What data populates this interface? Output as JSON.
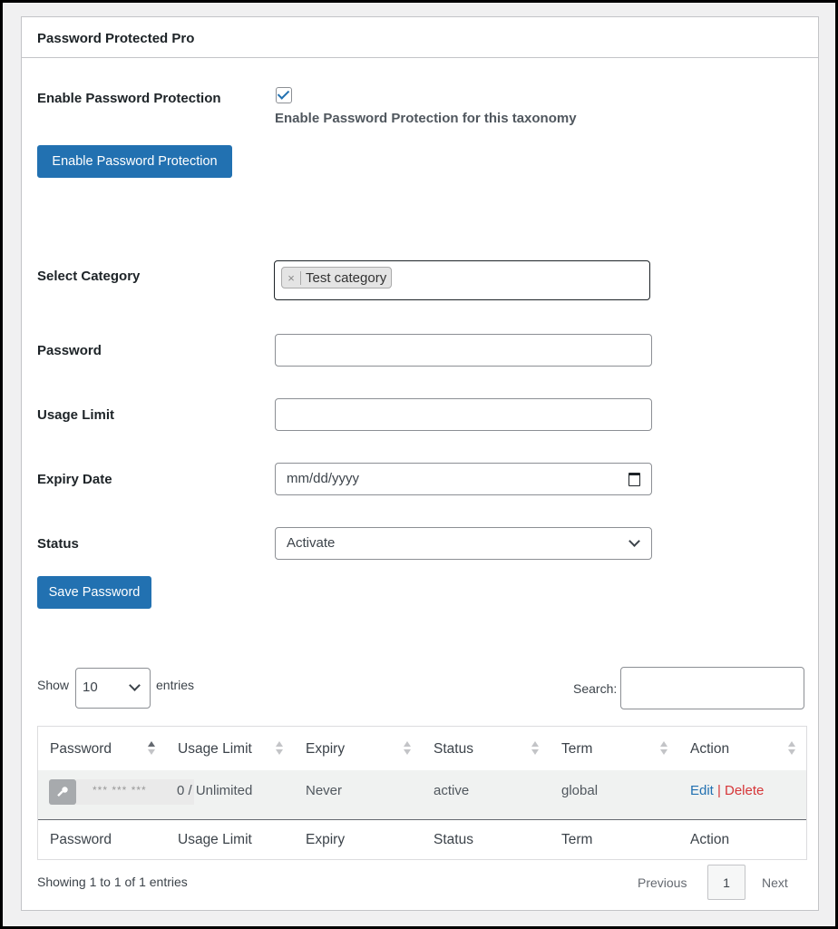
{
  "panel": {
    "title": "Password Protected Pro"
  },
  "enable": {
    "label": "Enable Password Protection",
    "checked": true,
    "description": "Enable Password Protection for this taxonomy",
    "button": "Enable Password Protection"
  },
  "form": {
    "category_label": "Select Category",
    "category_chip": "Test category",
    "category_chip_remove": "×",
    "password_label": "Password",
    "usage_label": "Usage Limit",
    "expiry_label": "Expiry Date",
    "expiry_placeholder": "mm/dd/yyyy",
    "status_label": "Status",
    "status_value": "Activate",
    "save_button": "Save Password"
  },
  "table_controls": {
    "show": "Show",
    "length": "10",
    "entries": "entries",
    "search": "Search:"
  },
  "table": {
    "headers": [
      "Password",
      "Usage Limit",
      "Expiry",
      "Status",
      "Term",
      "Action"
    ],
    "row": {
      "masked": "*** *** ***",
      "usage": "0 / Unlimited",
      "expiry": "Never",
      "status": "active",
      "term": "global",
      "edit": "Edit",
      "sep": "|",
      "delete": "Delete"
    },
    "footers": [
      "Password",
      "Usage Limit",
      "Expiry",
      "Status",
      "Term",
      "Action"
    ]
  },
  "pagination": {
    "info": "Showing 1 to 1 of 1 entries",
    "previous": "Previous",
    "page": "1",
    "next": "Next"
  },
  "colors": {
    "primary": "#2271b1",
    "delete": "#d63638",
    "link": "#2271b1"
  }
}
